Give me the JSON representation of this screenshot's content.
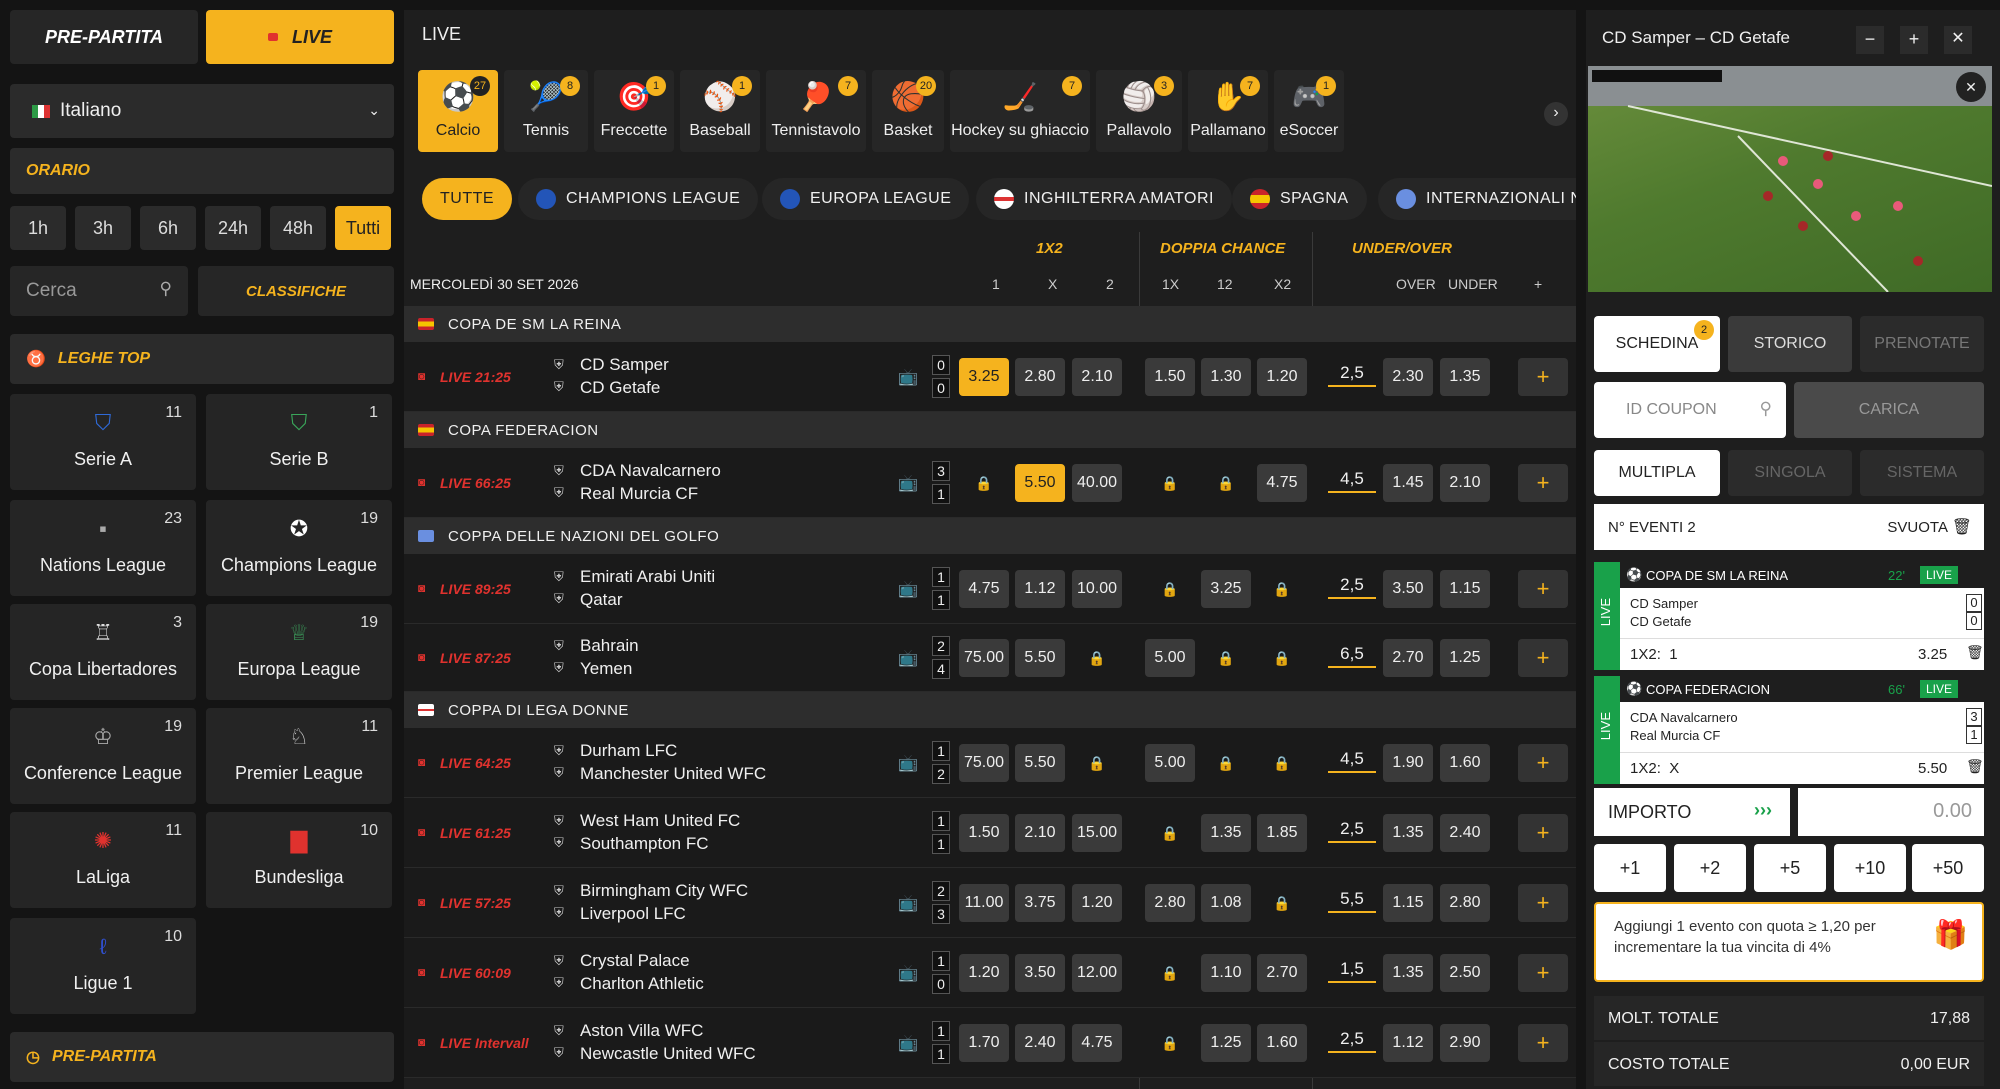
{
  "left": {
    "prematch_label": "PRE-PARTITA",
    "live_label": "LIVE",
    "language": "Italiano",
    "orario_label": "ORARIO",
    "time_filters": [
      "1h",
      "3h",
      "6h",
      "24h",
      "48h",
      "Tutti"
    ],
    "search_placeholder": "Cerca",
    "classifiche_label": "CLASSIFICHE",
    "leghe_top_label": "LEGHE TOP",
    "leagues": [
      {
        "name": "Serie A",
        "count": "11",
        "icon": "serie-a-icon"
      },
      {
        "name": "Serie B",
        "count": "1",
        "icon": "serie-b-icon"
      },
      {
        "name": "Nations League",
        "count": "23",
        "icon": "nations-league-icon"
      },
      {
        "name": "Champions League",
        "count": "19",
        "icon": "champions-league-icon"
      },
      {
        "name": "Copa Libertadores",
        "count": "3",
        "icon": "copa-libertadores-icon"
      },
      {
        "name": "Europa League",
        "count": "19",
        "icon": "europa-league-icon"
      },
      {
        "name": "Conference League",
        "count": "19",
        "icon": "conference-league-icon"
      },
      {
        "name": "Premier League",
        "count": "11",
        "icon": "premier-league-icon"
      },
      {
        "name": "LaLiga",
        "count": "11",
        "icon": "laliga-icon"
      },
      {
        "name": "Bundesliga",
        "count": "10",
        "icon": "bundesliga-icon"
      },
      {
        "name": "Ligue 1",
        "count": "10",
        "icon": "ligue-1-icon"
      }
    ],
    "prepartita_footer": "PRE-PARTITA"
  },
  "center": {
    "title": "LIVE",
    "sports": [
      {
        "name": "Calcio",
        "count": "27"
      },
      {
        "name": "Tennis",
        "count": "8"
      },
      {
        "name": "Freccette",
        "count": "1"
      },
      {
        "name": "Baseball",
        "count": "1"
      },
      {
        "name": "Tennistavolo",
        "count": "7"
      },
      {
        "name": "Basket",
        "count": "20"
      },
      {
        "name": "Hockey su ghiaccio",
        "count": "7"
      },
      {
        "name": "Pallavolo",
        "count": "3"
      },
      {
        "name": "Pallamano",
        "count": "7"
      },
      {
        "name": "eSoccer",
        "count": "1"
      }
    ],
    "filters": [
      "TUTTE",
      "CHAMPIONS LEAGUE",
      "EUROPA LEAGUE",
      "INGHILTERRA AMATORI",
      "SPAGNA",
      "INTERNAZIONALI N"
    ],
    "date_label": "MERCOLEDÌ 30 SET 2026",
    "headers": {
      "h1x2": "1X2",
      "doppia": "DOPPIA CHANCE",
      "uo": "UNDER/OVER",
      "c1": "1",
      "cx": "X",
      "c2": "2",
      "d1x": "1X",
      "d12": "12",
      "dx2": "X2",
      "over": "OVER",
      "under": "UNDER",
      "plus": "+"
    },
    "groups": [
      {
        "name": "COPA DE SM LA REINA"
      },
      {
        "name": "COPA FEDERACION"
      },
      {
        "name": "COPPA DELLE NAZIONI DEL GOLFO"
      },
      {
        "name": "COPPA DI LEGA DONNE"
      }
    ],
    "matches": [
      {
        "time": "LIVE 21:25",
        "home": "CD Samper",
        "away": "CD Getafe",
        "sh": "0",
        "sa": "0",
        "o1": "3.25",
        "ox": "2.80",
        "o2": "2.10",
        "d1x": "1.50",
        "d12": "1.30",
        "dx2": "1.20",
        "line": "2,5",
        "over": "2.30",
        "under": "1.35"
      },
      {
        "time": "LIVE 66:25",
        "home": "CDA Navalcarnero",
        "away": "Real Murcia CF",
        "sh": "3",
        "sa": "1",
        "o1": "",
        "ox": "5.50",
        "o2": "40.00",
        "d1x": "",
        "d12": "",
        "dx2": "4.75",
        "line": "4,5",
        "over": "1.45",
        "under": "2.10"
      },
      {
        "time": "LIVE 89:25",
        "home": "Emirati Arabi Uniti",
        "away": "Qatar",
        "sh": "1",
        "sa": "1",
        "o1": "4.75",
        "ox": "1.12",
        "o2": "10.00",
        "d1x": "",
        "d12": "3.25",
        "dx2": "",
        "line": "2,5",
        "over": "3.50",
        "under": "1.15"
      },
      {
        "time": "LIVE 87:25",
        "home": "Bahrain",
        "away": "Yemen",
        "sh": "2",
        "sa": "4",
        "o1": "75.00",
        "ox": "5.50",
        "o2": "",
        "d1x": "5.00",
        "d12": "",
        "dx2": "",
        "line": "6,5",
        "over": "2.70",
        "under": "1.25"
      },
      {
        "time": "LIVE 64:25",
        "home": "Durham LFC",
        "away": "Manchester United WFC",
        "sh": "1",
        "sa": "2",
        "o1": "75.00",
        "ox": "5.50",
        "o2": "",
        "d1x": "5.00",
        "d12": "",
        "dx2": "",
        "line": "4,5",
        "over": "1.90",
        "under": "1.60"
      },
      {
        "time": "LIVE 61:25",
        "home": "West Ham United FC",
        "away": "Southampton FC",
        "sh": "1",
        "sa": "1",
        "o1": "1.50",
        "ox": "2.10",
        "o2": "15.00",
        "d1x": "",
        "d12": "1.35",
        "dx2": "1.85",
        "line": "2,5",
        "over": "1.35",
        "under": "2.40"
      },
      {
        "time": "LIVE 57:25",
        "home": "Birmingham City WFC",
        "away": "Liverpool LFC",
        "sh": "2",
        "sa": "3",
        "o1": "11.00",
        "ox": "3.75",
        "o2": "1.20",
        "d1x": "2.80",
        "d12": "1.08",
        "dx2": "",
        "line": "5,5",
        "over": "1.15",
        "under": "2.80"
      },
      {
        "time": "LIVE 60:09",
        "home": "Crystal Palace",
        "away": "Charlton Athletic",
        "sh": "1",
        "sa": "0",
        "o1": "1.20",
        "ox": "3.50",
        "o2": "12.00",
        "d1x": "",
        "d12": "1.10",
        "dx2": "2.70",
        "line": "1,5",
        "over": "1.35",
        "under": "2.50"
      },
      {
        "time": "LIVE Intervall",
        "home": "Aston Villa WFC",
        "away": "Newcastle United WFC",
        "sh": "1",
        "sa": "1",
        "o1": "1.70",
        "ox": "2.40",
        "o2": "4.75",
        "d1x": "",
        "d12": "1.25",
        "dx2": "1.60",
        "line": "2,5",
        "over": "1.12",
        "under": "2.90"
      }
    ]
  },
  "right": {
    "match_title": "CD Samper – CD Getafe",
    "tabs": [
      "SCHEDINA",
      "STORICO",
      "PRENOTATE"
    ],
    "schedina_badge": "2",
    "coupon_placeholder": "ID COUPON",
    "carica_label": "CARICA",
    "modes": [
      "MULTIPLA",
      "SINGOLA",
      "SISTEMA"
    ],
    "n_eventi": "N° EVENTI 2",
    "svuota": "SVUOTA",
    "bets": [
      {
        "league": "COPA DE SM LA REINA",
        "minute": "22'",
        "live": "LIVE",
        "home": "CD Samper",
        "away": "CD Getafe",
        "sh": "0",
        "sa": "0",
        "market": "1X2:  1",
        "odd": "3.25",
        "side": "LIVE"
      },
      {
        "league": "COPA FEDERACION",
        "minute": "66'",
        "live": "LIVE",
        "home": "CDA Navalcarnero",
        "away": "Real Murcia CF",
        "sh": "3",
        "sa": "1",
        "market": "1X2:  X",
        "odd": "5.50",
        "side": "LIVE"
      }
    ],
    "importo_label": "IMPORTO",
    "importo_value": "0.00",
    "quick": [
      "+1",
      "+2",
      "+5",
      "+10",
      "+50"
    ],
    "promo": "Aggiungi 1 evento con quota ≥ 1,20 per incrementare la tua vincita di 4%",
    "molt_label": "MOLT. TOTALE",
    "molt_value": "17,88",
    "costo_label": "COSTO TOTALE",
    "costo_value": "0,00 EUR"
  }
}
